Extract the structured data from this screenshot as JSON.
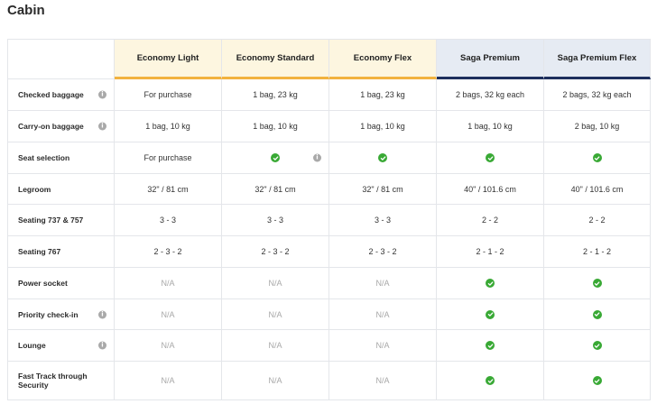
{
  "page_title": "Cabin",
  "columns": [
    {
      "label": "Economy Light",
      "group": "economy"
    },
    {
      "label": "Economy Standard",
      "group": "economy"
    },
    {
      "label": "Economy Flex",
      "group": "economy"
    },
    {
      "label": "Saga Premium",
      "group": "saga"
    },
    {
      "label": "Saga Premium Flex",
      "group": "saga"
    }
  ],
  "colors": {
    "economy_accent": "#f2b23f",
    "economy_header_bg": "#fdf6e0",
    "saga_accent": "#1e2f5d",
    "saga_header_bg": "#e6ebf3",
    "check_green": "#39a935"
  },
  "rows": [
    {
      "label": "Checked baggage",
      "info": true,
      "cells": [
        {
          "text": "For purchase"
        },
        {
          "text": "1 bag, 23 kg"
        },
        {
          "text": "1 bag, 23 kg"
        },
        {
          "text": "2 bags, 32 kg each"
        },
        {
          "text": "2 bags, 32 kg each"
        }
      ]
    },
    {
      "label": "Carry-on baggage",
      "info": true,
      "cells": [
        {
          "text": "1 bag, 10 kg"
        },
        {
          "text": "1 bag, 10 kg"
        },
        {
          "text": "1 bag, 10 kg"
        },
        {
          "text": "1 bag, 10 kg"
        },
        {
          "text": "2 bag, 10 kg"
        }
      ]
    },
    {
      "label": "Seat selection",
      "info": false,
      "cells": [
        {
          "text": "For purchase"
        },
        {
          "check": true,
          "info": true
        },
        {
          "check": true
        },
        {
          "check": true
        },
        {
          "check": true
        }
      ]
    },
    {
      "label": "Legroom",
      "info": false,
      "cells": [
        {
          "text": "32\" / 81 cm"
        },
        {
          "text": "32\" / 81 cm"
        },
        {
          "text": "32\" / 81 cm"
        },
        {
          "text": "40\" / 101.6 cm"
        },
        {
          "text": "40\" / 101.6 cm"
        }
      ]
    },
    {
      "label": "Seating 737 & 757",
      "info": false,
      "cells": [
        {
          "text": "3 - 3"
        },
        {
          "text": "3 - 3"
        },
        {
          "text": "3 - 3"
        },
        {
          "text": "2 - 2"
        },
        {
          "text": "2 - 2"
        }
      ]
    },
    {
      "label": "Seating 767",
      "info": false,
      "cells": [
        {
          "text": "2 - 3 - 2"
        },
        {
          "text": "2 - 3 - 2"
        },
        {
          "text": "2 - 3 - 2"
        },
        {
          "text": "2 - 1 - 2"
        },
        {
          "text": "2 - 1 - 2"
        }
      ]
    },
    {
      "label": "Power socket",
      "info": false,
      "cells": [
        {
          "text": "N/A",
          "na": true
        },
        {
          "text": "N/A",
          "na": true
        },
        {
          "text": "N/A",
          "na": true
        },
        {
          "check": true
        },
        {
          "check": true
        }
      ]
    },
    {
      "label": "Priority check-in",
      "info": true,
      "cells": [
        {
          "text": "N/A",
          "na": true
        },
        {
          "text": "N/A",
          "na": true
        },
        {
          "text": "N/A",
          "na": true
        },
        {
          "check": true
        },
        {
          "check": true
        }
      ]
    },
    {
      "label": "Lounge",
      "info": true,
      "cells": [
        {
          "text": "N/A",
          "na": true
        },
        {
          "text": "N/A",
          "na": true
        },
        {
          "text": "N/A",
          "na": true
        },
        {
          "check": true
        },
        {
          "check": true
        }
      ]
    },
    {
      "label": "Fast Track through Security",
      "info": false,
      "cells": [
        {
          "text": "N/A",
          "na": true
        },
        {
          "text": "N/A",
          "na": true
        },
        {
          "text": "N/A",
          "na": true
        },
        {
          "check": true
        },
        {
          "check": true
        }
      ]
    }
  ]
}
